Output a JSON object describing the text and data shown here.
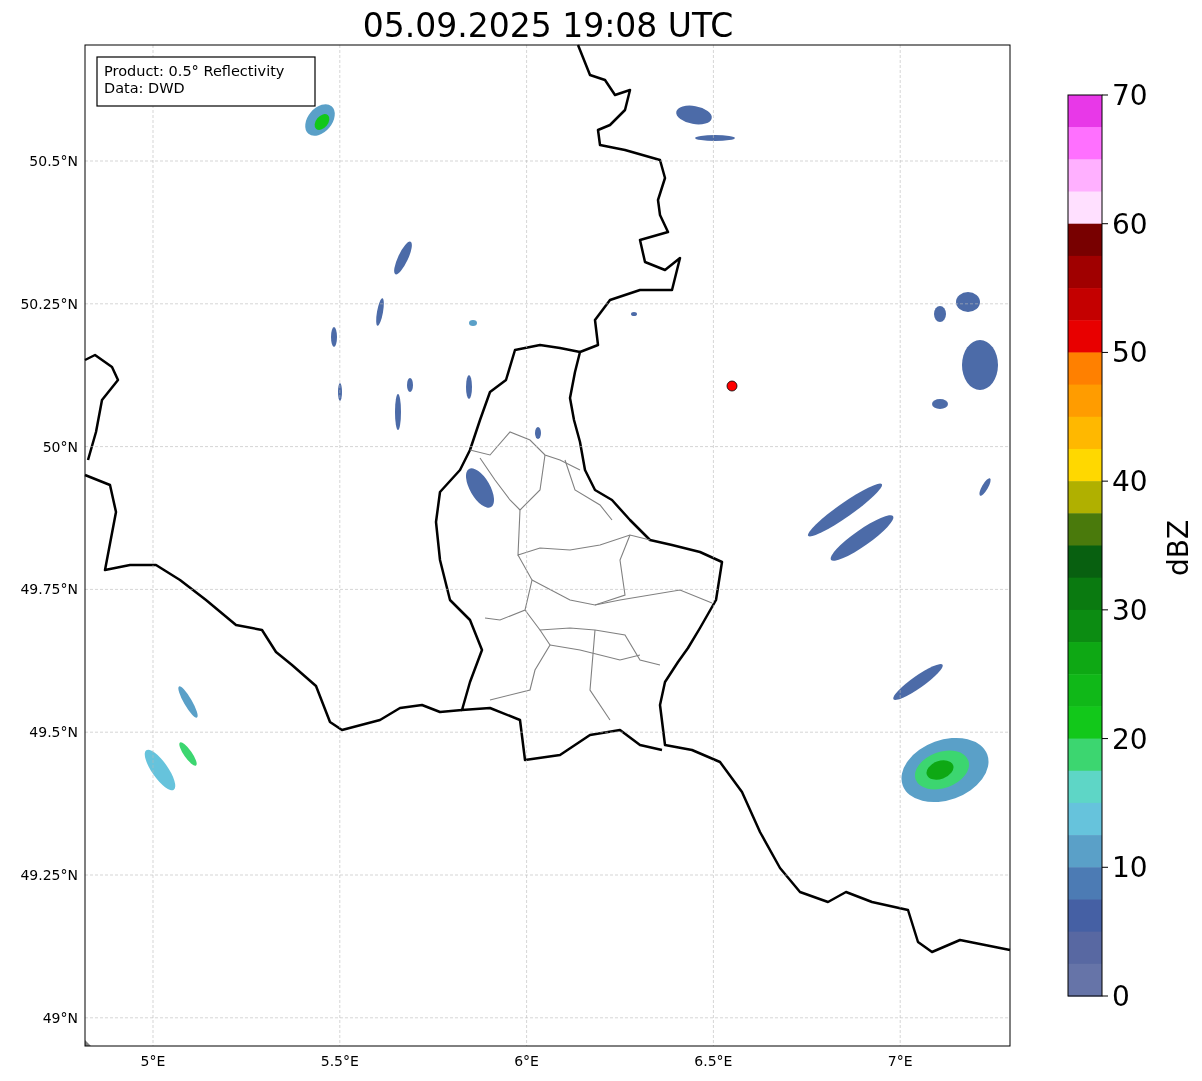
{
  "title": "05.09.2025 19:08 UTC",
  "info_box": [
    "Product: 0.5° Reflectivity",
    "Data: DWD"
  ],
  "y_ticks": [
    "50.5°N",
    "50.25°N",
    "50°N",
    "49.75°N",
    "49.5°N",
    "49.25°N",
    "49°N"
  ],
  "x_ticks": [
    "5°E",
    "5.5°E",
    "6°E",
    "6.5°E",
    "7°E"
  ],
  "colorbar": {
    "label": "dBZ",
    "ticks": [
      "70",
      "60",
      "50",
      "40",
      "30",
      "20",
      "10",
      "0"
    ],
    "levels": [
      {
        "color": "#e838e8"
      },
      {
        "color": "#ff70ff"
      },
      {
        "color": "#ffb0ff"
      },
      {
        "color": "#ffe0ff"
      },
      {
        "color": "#780000"
      },
      {
        "color": "#a00000"
      },
      {
        "color": "#c40000"
      },
      {
        "color": "#e80000"
      },
      {
        "color": "#ff8000"
      },
      {
        "color": "#ff9c00"
      },
      {
        "color": "#ffb800"
      },
      {
        "color": "#ffd800"
      },
      {
        "color": "#b0b000"
      },
      {
        "color": "#4a7a0c"
      },
      {
        "color": "#086010"
      },
      {
        "color": "#0a7a10"
      },
      {
        "color": "#0c8c12"
      },
      {
        "color": "#0ea814"
      },
      {
        "color": "#10b818"
      },
      {
        "color": "#12c81a"
      },
      {
        "color": "#3cd670"
      },
      {
        "color": "#5ed6c6"
      },
      {
        "color": "#66c3dc"
      },
      {
        "color": "#5aa0c8"
      },
      {
        "color": "#4c7bb4"
      },
      {
        "color": "#4560a4"
      },
      {
        "color": "#5868a2"
      },
      {
        "color": "#6674a8"
      }
    ]
  }
}
